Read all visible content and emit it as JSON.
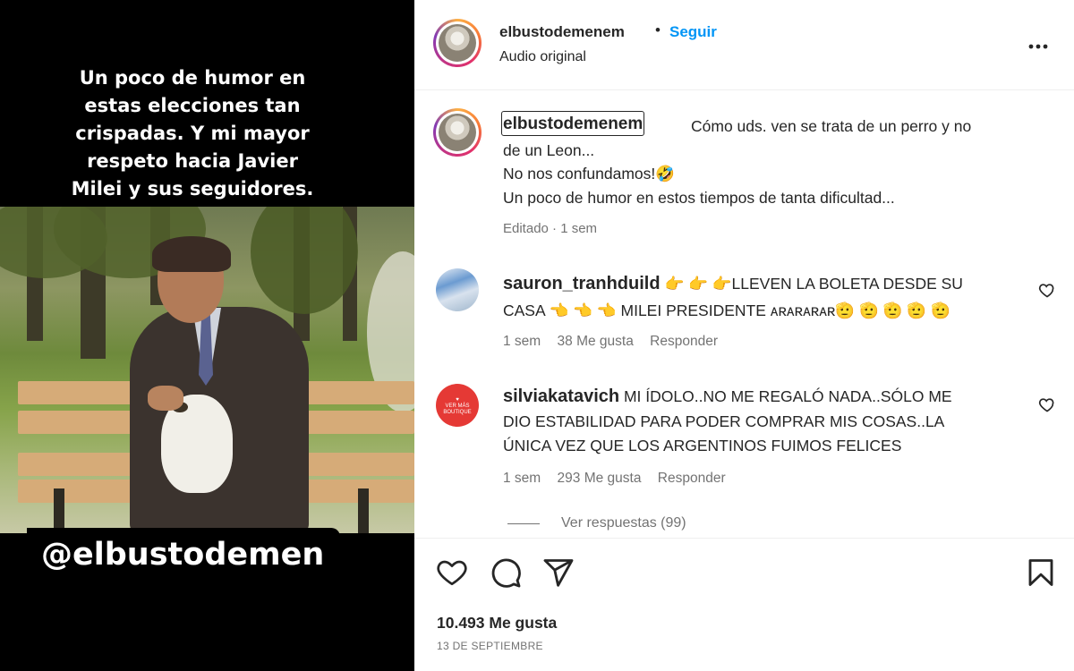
{
  "media": {
    "overlay_caption": "Un poco de humor en\nestas elecciones tan\ncrispadas. Y mi mayor\nrespeto hacia Javier\nMilei y sus seguidores.",
    "handle_banner": "@elbustodemen"
  },
  "header": {
    "username": "elbustodemenem",
    "separator": "•",
    "follow_label": "Seguir",
    "audio_label": "Audio original",
    "more_icon": "more-horizontal-icon"
  },
  "caption": {
    "username": "elbustodemenem",
    "line1": "Cómo uds. ven se trata de un perro y no",
    "line2": "de un Leon...",
    "line3": "No nos confundamos!🤣",
    "line4": "Un poco de humor en estos tiempos de tanta dificultad...",
    "meta": "Editado · 1 sem"
  },
  "comments": [
    {
      "username": "sauron_tranhduild",
      "line1": "👉 👉 👉LLEVEN LA BOLETA DESDE SU",
      "line2": "CASA 👈 👈 👈 MILEI PRESIDENTE ᴀʀᴀʀᴀʀᴀʀ🫡 🫡 🫡 🫡 🫡",
      "time": "1 sem",
      "likes": "38 Me gusta",
      "reply": "Responder"
    },
    {
      "username": "silviakatavich",
      "line1": "MI ÍDOLO..NO ME REGALÓ NADA..SÓLO ME",
      "line2": "DIO ESTABILIDAD PARA PODER COMPRAR MIS COSAS..LA",
      "line3": "ÚNICA VEZ QUE LOS ARGENTINOS FUIMOS FELICES",
      "time": "1 sem",
      "likes": "293 Me gusta",
      "reply": "Responder"
    }
  ],
  "view_replies": "Ver respuestas (99)",
  "actions": {
    "icons": [
      "heart-icon",
      "comment-icon",
      "share-icon",
      "bookmark-icon"
    ],
    "likes": "10.493 Me gusta",
    "date": "13 DE SEPTIEMBRE"
  },
  "colors": {
    "link_blue": "#0095f6",
    "text": "#262626",
    "secondary": "#737373"
  }
}
